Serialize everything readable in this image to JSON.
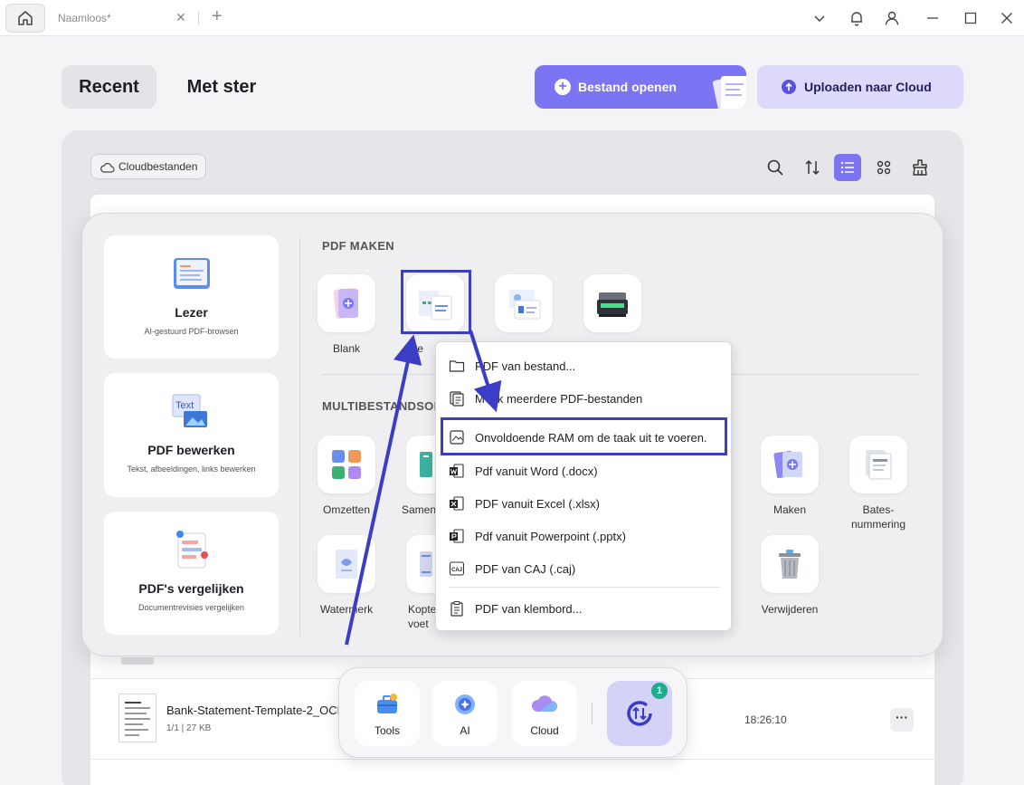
{
  "titlebar": {
    "tab_title": "Naamloos*",
    "close_tab": "✕",
    "add_tab": "+"
  },
  "header": {
    "recent_label": "Recent",
    "starred_label": "Met ster",
    "open_file_label": "Bestand openen",
    "upload_cloud_label": "Uploaden naar Cloud",
    "accent_color": "#7b74f3"
  },
  "toolbar": {
    "cloud_files_label": "Cloudbestanden",
    "icons": [
      "search-icon",
      "sort-icon",
      "list-view-icon",
      "grid-view-icon",
      "clean-icon"
    ],
    "active_view": "list"
  },
  "tools_panel": {
    "features": [
      {
        "title": "Lezer",
        "subtitle": "AI-gestuurd PDF-browsen"
      },
      {
        "title": "PDF bewerken",
        "subtitle": "Tekst, afbeeldingen, links bewerken"
      },
      {
        "title": "PDF's vergelijken",
        "subtitle": "Documentrevisies vergelijken"
      }
    ],
    "create_section_title": "PDF MAKEN",
    "create_tiles": [
      {
        "label": "Blank"
      },
      {
        "label": "Ove"
      }
    ],
    "multi_section_title": "MULTIBESTANDSOI",
    "multi_tiles": [
      {
        "label": "Omzetten"
      },
      {
        "label": "Samen"
      },
      {
        "label": "Maken"
      },
      {
        "label": "Bates-nummering"
      },
      {
        "label": "Watermerk"
      },
      {
        "label": "Kopte voet"
      },
      {
        "label": "Verwijderen"
      }
    ]
  },
  "dropdown": {
    "items": [
      {
        "label": "PDF van bestand...",
        "icon": "folder-icon"
      },
      {
        "label": "Maak meerdere PDF-bestanden",
        "icon": "multi-file-icon"
      },
      {
        "label": "Onvoldoende RAM om de taak uit te voeren.",
        "icon": "image-file-icon"
      },
      {
        "label": "Pdf vanuit Word (.docx)",
        "icon": "word-icon"
      },
      {
        "label": "PDF vanuit Excel (.xlsx)",
        "icon": "excel-icon"
      },
      {
        "label": "Pdf vanuit Powerpoint (.pptx)",
        "icon": "powerpoint-icon"
      },
      {
        "label": "PDF van CAJ (.caj)",
        "icon": "caj-icon"
      },
      {
        "label": "PDF van klembord...",
        "icon": "clipboard-icon"
      }
    ],
    "item_3_prefix": "M",
    "item_3_rest": "k meerdere PDF-bestanden"
  },
  "file_row": {
    "name": "Bank-Statement-Template-2_OCR",
    "meta": "1/1 | 27 KB",
    "time": "18:26:10",
    "more": "···"
  },
  "dock": {
    "tools_label": "Tools",
    "ai_label": "AI",
    "cloud_label": "Cloud",
    "sync_badge": "1"
  },
  "caj_icon_text": "CAJ",
  "text_icon_text": "Text"
}
